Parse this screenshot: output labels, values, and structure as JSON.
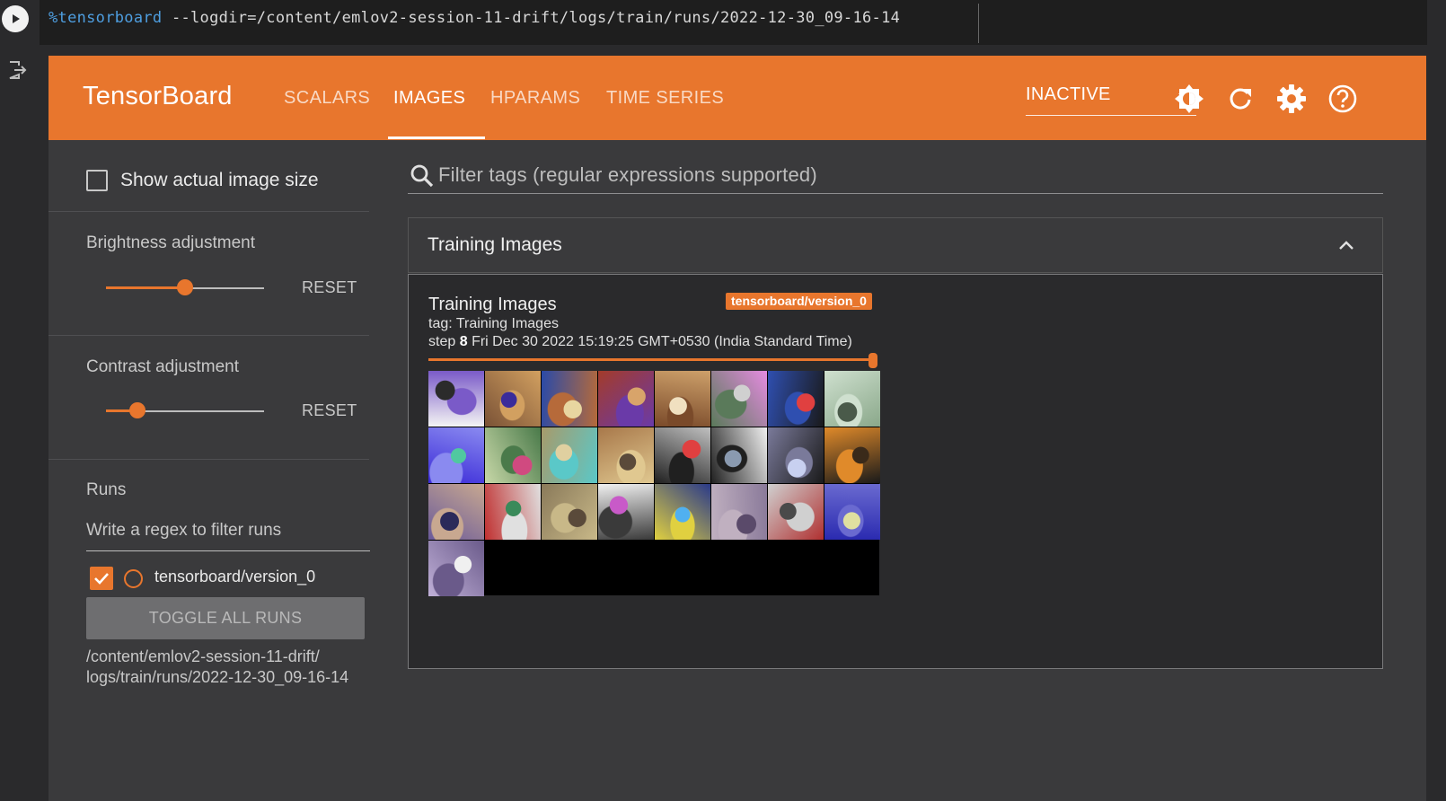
{
  "cell": {
    "code_magic": "%tensorboard",
    "code_args": " --logdir=/content/emlov2-session-11-drift/logs/train/runs/2022-12-30_09-16-14"
  },
  "tensorboard": {
    "brand": "TensorBoard",
    "tabs": [
      "SCALARS",
      "IMAGES",
      "HPARAMS",
      "TIME SERIES"
    ],
    "active_tab": "IMAGES",
    "status": "INACTIVE",
    "toolbar_icons": [
      "brightness-icon",
      "refresh-icon",
      "settings-gear-icon",
      "help-icon"
    ]
  },
  "sidebar": {
    "show_actual_size": "Show actual image size",
    "brightness_label": "Brightness adjustment",
    "brightness_level": 0.5,
    "contrast_label": "Contrast adjustment",
    "contrast_level": 0.2,
    "reset_label": "RESET",
    "runs_label": "Runs",
    "runs_filter_placeholder": "Write a regex to filter runs",
    "run_name": "tensorboard/version_0",
    "toggle_all": "TOGGLE ALL RUNS",
    "logdir_line1": "/content/emlov2-session-11-drift/",
    "logdir_line2": "logs/train/runs/2022-12-30_09-16-14"
  },
  "main": {
    "filter_placeholder": "Filter tags (regular expressions supported)",
    "card_title": "Training Images",
    "image": {
      "title": "Training Images",
      "run_tag": "tensorboard/version_0",
      "tag_line": "tag: Training Images",
      "step_prefix": "step",
      "step": "8",
      "timestamp": "Fri Dec 30 2022 15:19:25 GMT+0530 (India Standard Time)",
      "step_progress": 1.0
    }
  },
  "colors": {
    "accent": "#e8762d",
    "background": "#3a3a3c"
  }
}
